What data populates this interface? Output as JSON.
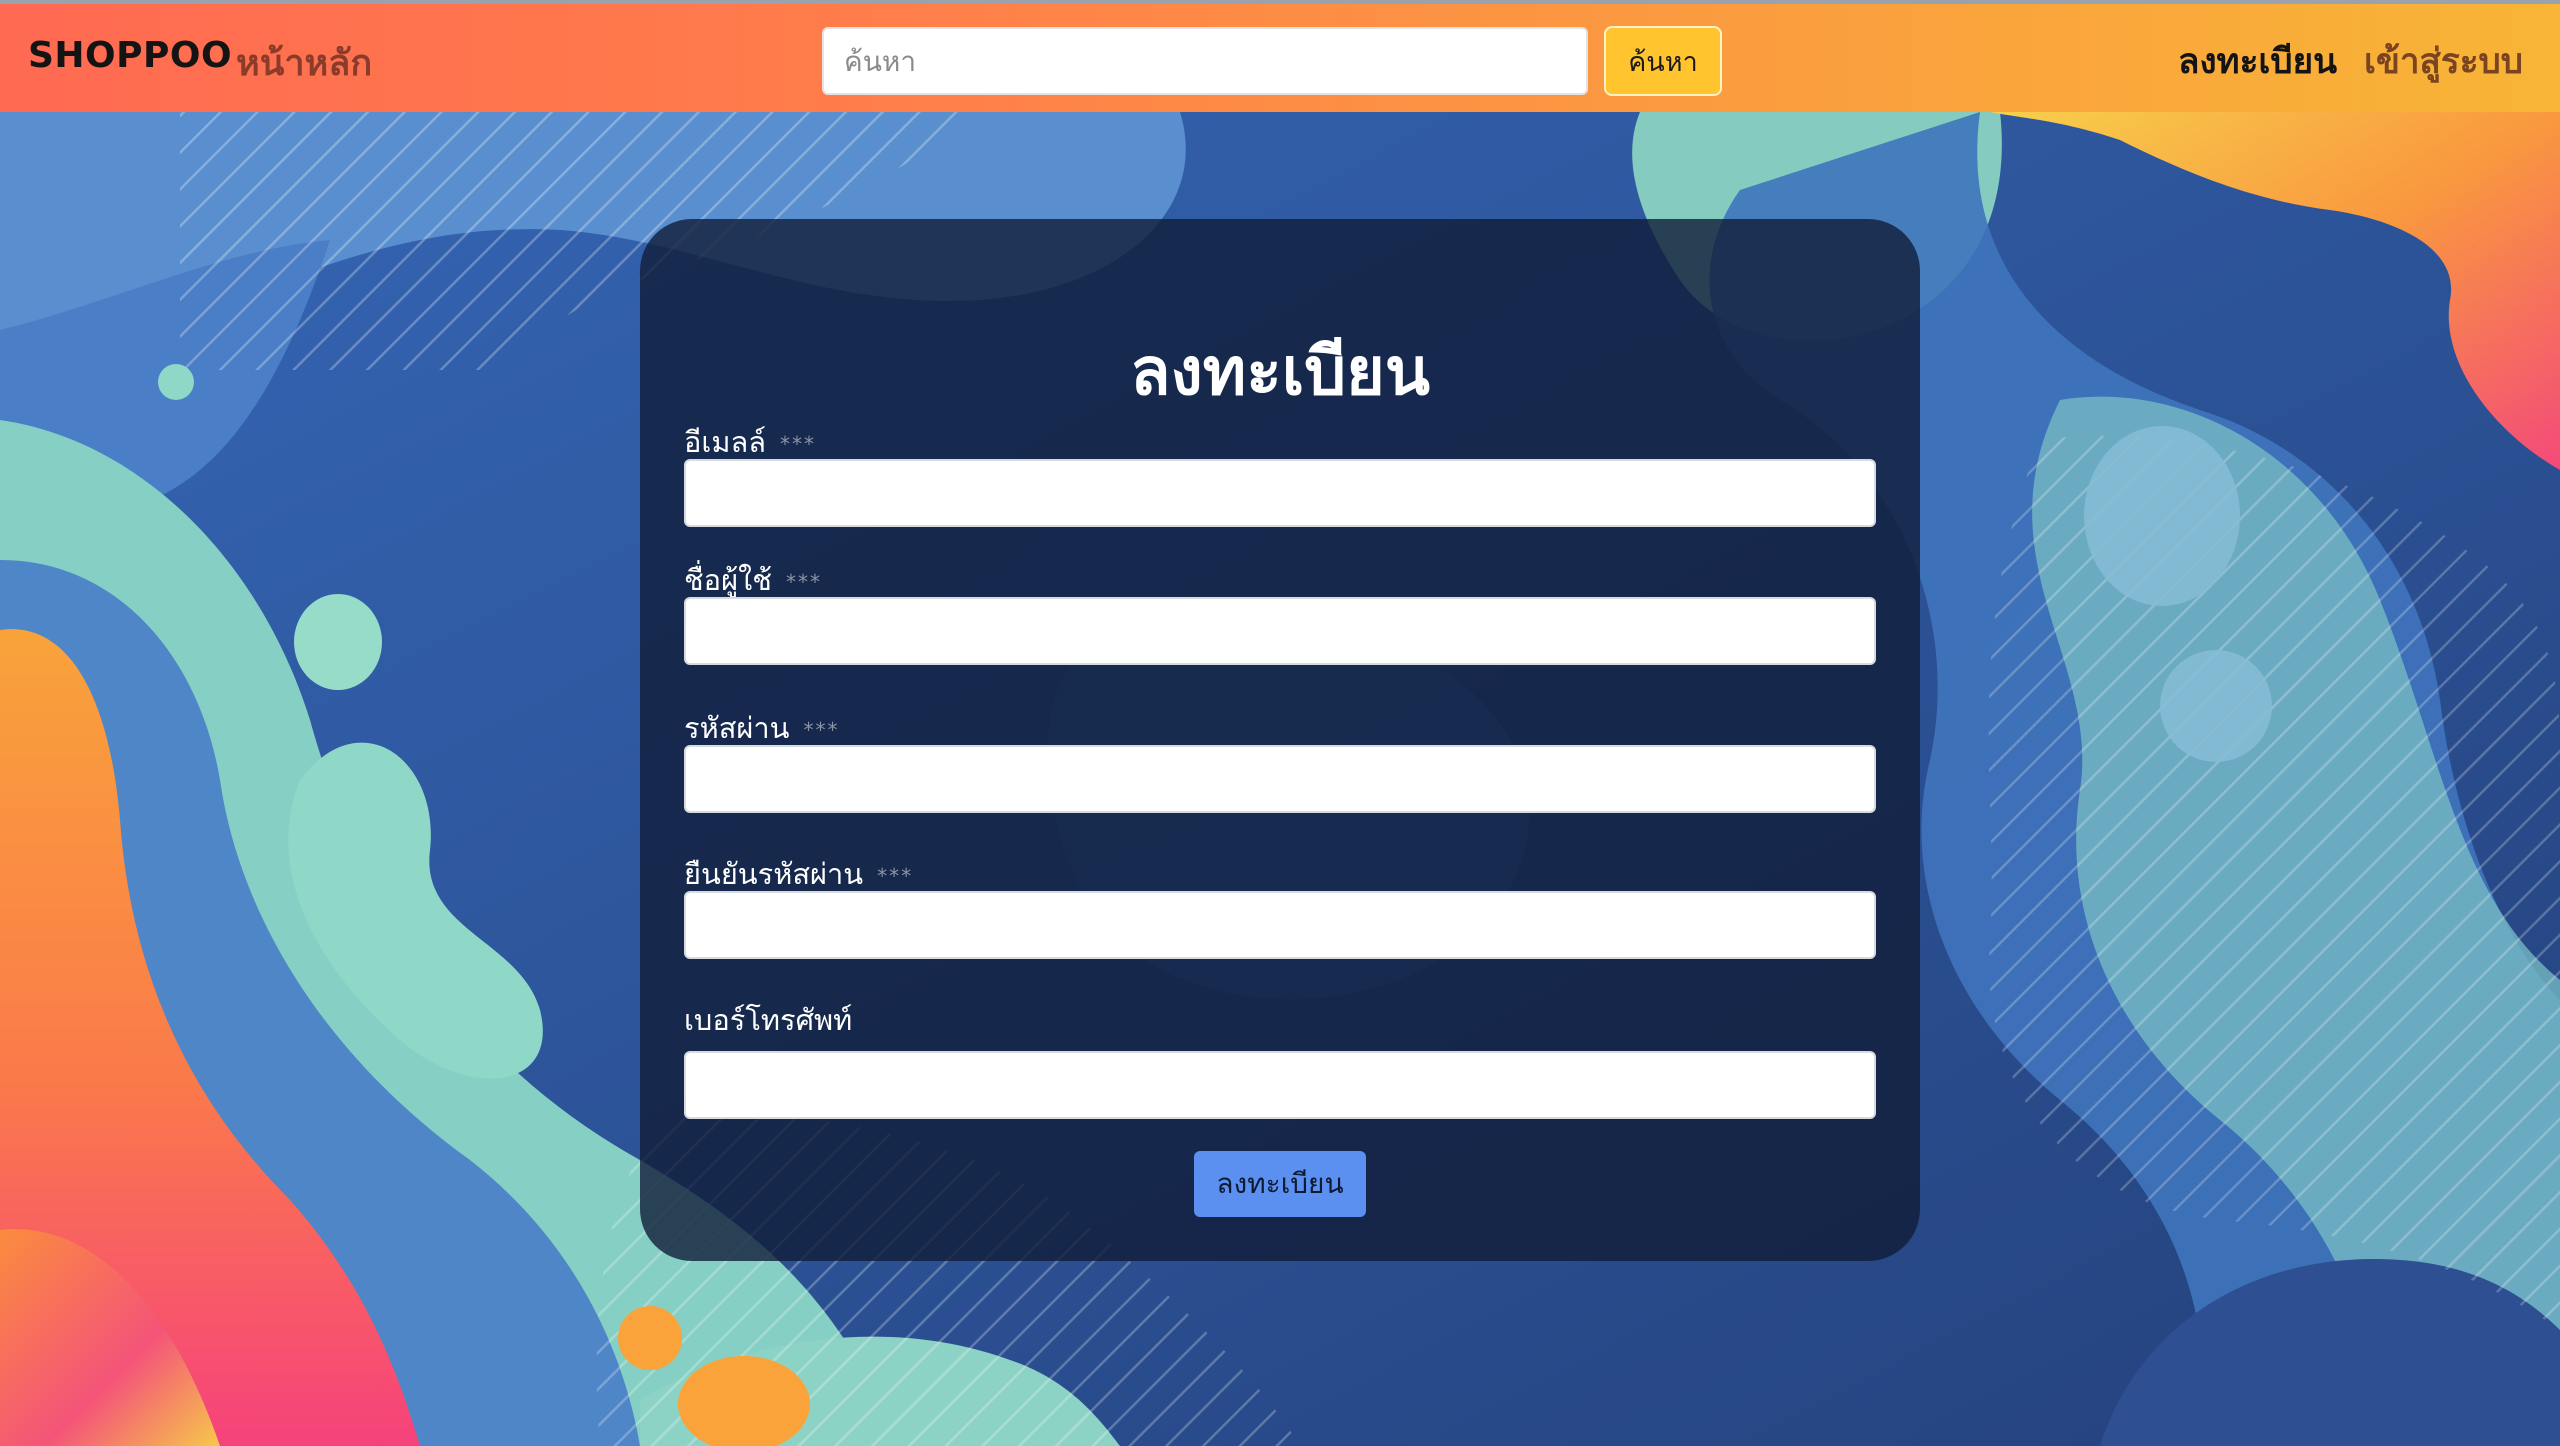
{
  "navbar": {
    "brand": "SHOPPOO",
    "home_label": "หน้าหลัก",
    "search_placeholder": "ค้นหา",
    "search_button_label": "ค้นหา",
    "register_label": "ลงทะเบียน",
    "login_label": "เข้าสู่ระบบ"
  },
  "form": {
    "title": "ลงทะเบียน",
    "required_marker": "***",
    "fields": [
      {
        "label": "อีเมลล์",
        "required": true,
        "value": ""
      },
      {
        "label": "ชื่อผู้ใช้",
        "required": true,
        "value": ""
      },
      {
        "label": "รหัสผ่าน",
        "required": true,
        "value": ""
      },
      {
        "label": "ยืนยันรหัสผ่าน",
        "required": true,
        "value": ""
      },
      {
        "label": "เบอร์โทรศัพท์",
        "required": false,
        "value": ""
      }
    ],
    "submit_label": "ลงทะเบียน"
  },
  "colors": {
    "navbar_gradient_start": "#ff6a52",
    "navbar_gradient_end": "#f8b536",
    "search_button": "#ffc42e",
    "card_background": "#101d38",
    "submit_button": "#5b8ff0",
    "background_blue": "#2d4f8e",
    "background_teal": "#8fd8c8",
    "background_orange": "#f9a33a",
    "background_pink": "#f8427a"
  }
}
